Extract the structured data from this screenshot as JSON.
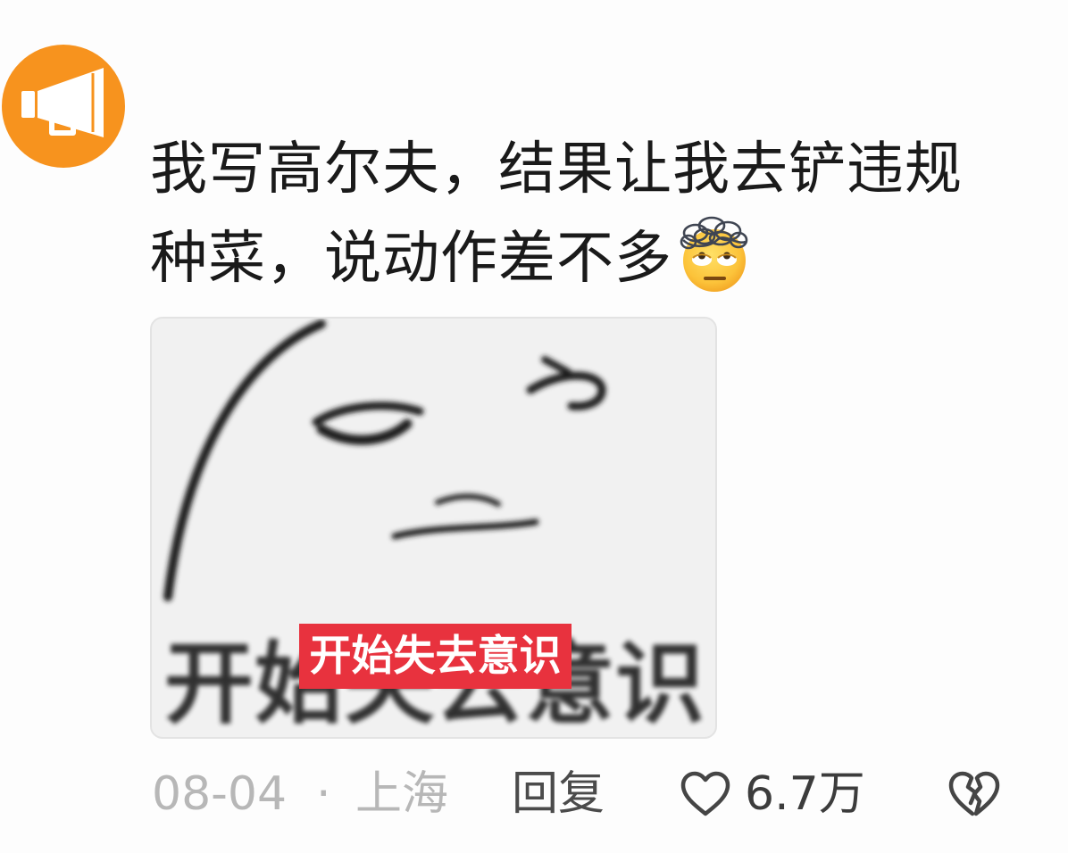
{
  "avatar": {
    "icon": "megaphone-icon",
    "background_color": "#f7931e"
  },
  "comment": {
    "lines": [
      "我写高尔夫，结果让我去铲违规",
      "种菜，说动作差不多"
    ],
    "emoji": "dizzy-face-emoji-icon"
  },
  "meme": {
    "background_text": "开始失去意识",
    "caption": "开始失去意识",
    "caption_color": "#e8323e"
  },
  "footer": {
    "date": "08-04",
    "separator": "·",
    "location": "上海",
    "reply_label": "回复",
    "like_icon": "heart-outline-icon",
    "like_count": "6.7万",
    "dislike_icon": "broken-heart-icon"
  }
}
